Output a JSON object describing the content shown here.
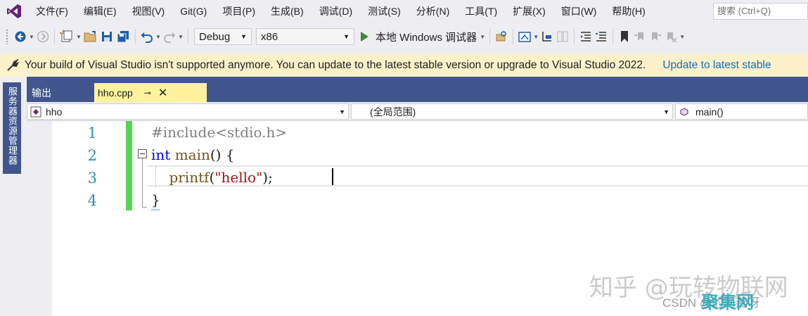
{
  "menu": {
    "items": [
      "文件(F)",
      "编辑(E)",
      "视图(V)",
      "Git(G)",
      "项目(P)",
      "生成(B)",
      "调试(D)",
      "测试(S)",
      "分析(N)",
      "工具(T)",
      "扩展(X)",
      "窗口(W)",
      "帮助(H)"
    ],
    "search_placeholder": "搜索 (Ctrl+Q)"
  },
  "toolbar": {
    "config": "Debug",
    "platform": "x86",
    "run_label": "本地 Windows 调试器"
  },
  "infobar": {
    "message": "Your build of Visual Studio isn't supported anymore. You can update to the latest stable version or upgrade to Visual Studio 2022.",
    "link": "Update to latest stable"
  },
  "side_panel": {
    "label": "服务器资源管理器"
  },
  "tabs": {
    "output_label": "输出",
    "active_file": "hho.cpp",
    "pin_glyph": "⊸",
    "close_glyph": "✕"
  },
  "nav": {
    "project": "hho",
    "scope": "(全局范围)",
    "member": "main()"
  },
  "editor": {
    "line_numbers": [
      "1",
      "2",
      "3",
      "4"
    ],
    "lines": [
      {
        "tokens": [
          {
            "cls": "pp",
            "text": "#include<stdio.h>"
          }
        ]
      },
      {
        "tokens": [
          {
            "cls": "kw",
            "text": "int"
          },
          {
            "cls": "plain",
            "text": " "
          },
          {
            "cls": "fn",
            "text": "main"
          },
          {
            "cls": "plain",
            "text": "() {"
          }
        ]
      },
      {
        "tokens": [
          {
            "cls": "plain",
            "text": "    "
          },
          {
            "cls": "fn",
            "text": "printf"
          },
          {
            "cls": "plain",
            "text": "("
          },
          {
            "cls": "str",
            "text": "\"hello\""
          },
          {
            "cls": "plain",
            "text": ");"
          }
        ]
      },
      {
        "tokens": [
          {
            "cls": "plain",
            "text": "}"
          }
        ]
      }
    ]
  },
  "watermark": {
    "zhihu": "知乎 @玩转物联网",
    "csdn": "CSDN @的阿燕呀",
    "logo": "聚集网"
  },
  "colors": {
    "accent": "#40568d",
    "active_tab": "#fff29d",
    "infobar": "#fcf1cb",
    "link": "#0e70c0"
  }
}
